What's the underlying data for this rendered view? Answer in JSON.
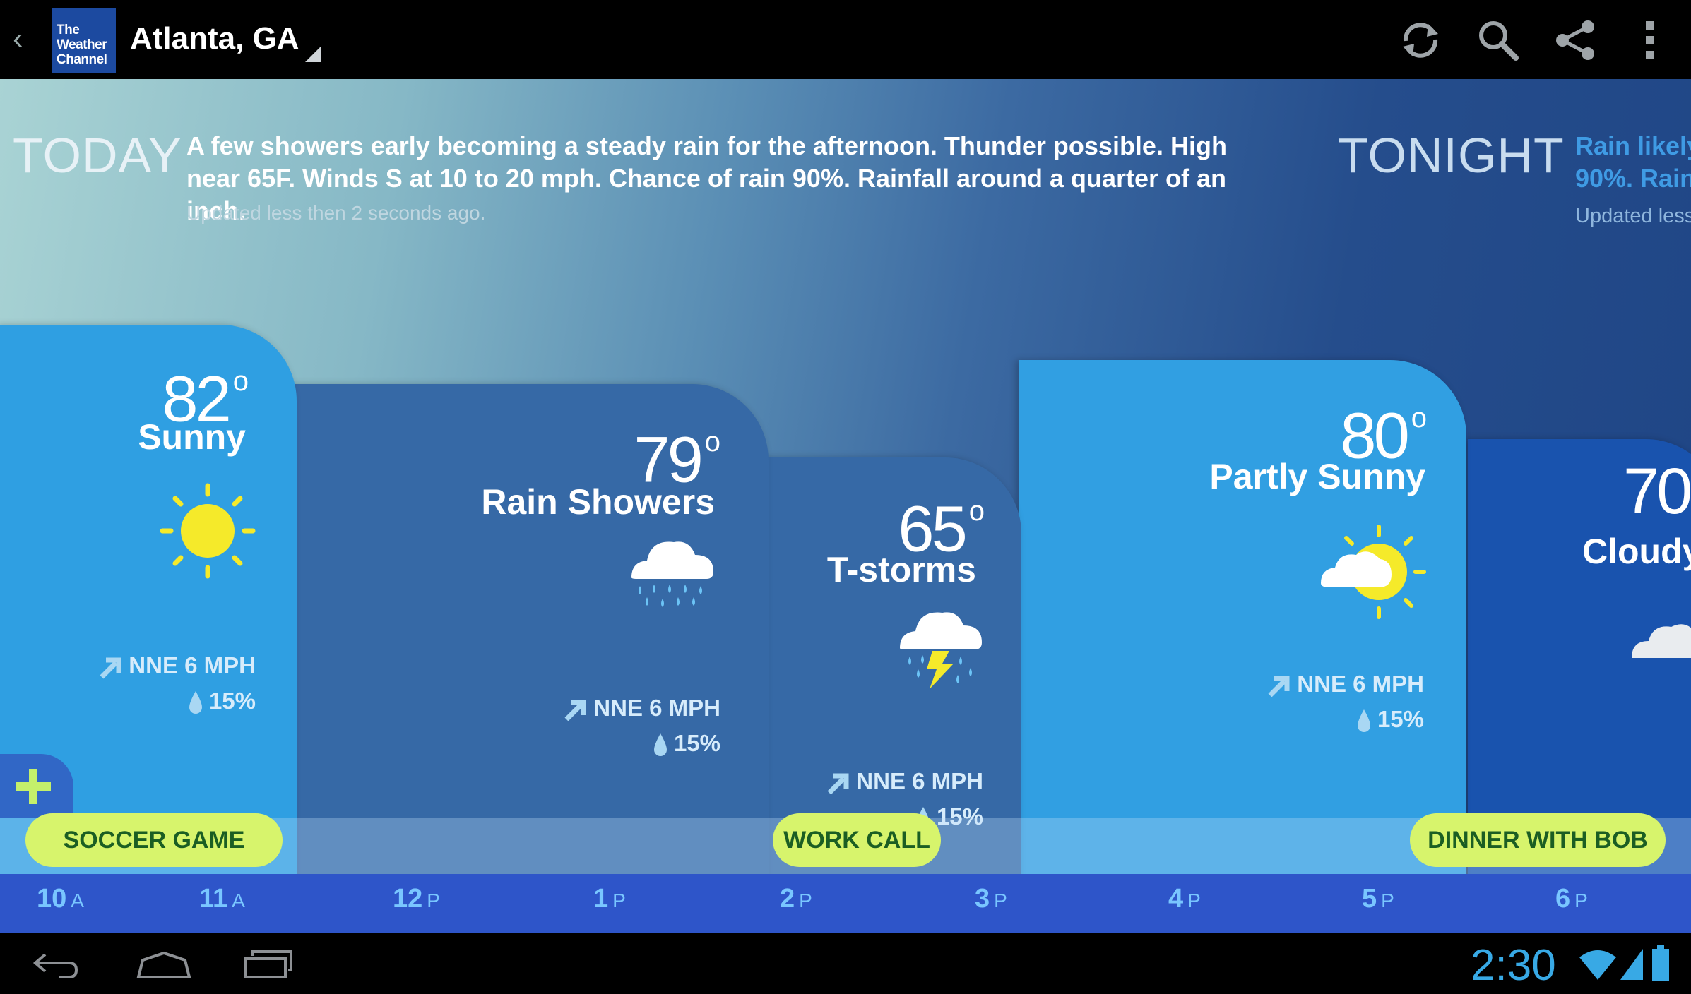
{
  "header": {
    "logo_lines": [
      "The",
      "Weather",
      "Channel"
    ],
    "city": "Atlanta, GA"
  },
  "today": {
    "label": "TODAY",
    "text": "A few showers early becoming a steady rain for the afternoon. Thunder possible. High near 65F. Winds S at 10 to 20 mph. Chance of rain 90%. Rainfall around a quarter of an inch.",
    "updated": "Updated less then 2 seconds ago."
  },
  "tonight": {
    "label": "TONIGHT",
    "text_line1": "Rain likely",
    "text_line2": "90%. Rain",
    "updated": "Updated less"
  },
  "forecasts": [
    {
      "temp": "82",
      "degree": "o",
      "condition": "Sunny",
      "wind": "NNE 6 MPH",
      "precip": "15%",
      "icon": "sun-icon"
    },
    {
      "temp": "79",
      "degree": "o",
      "condition": "Rain Showers",
      "wind": "NNE 6 MPH",
      "precip": "15%",
      "icon": "rain-cloud-icon"
    },
    {
      "temp": "65",
      "degree": "o",
      "condition": "T-storms",
      "wind": "NNE 6 MPH",
      "precip": "15%",
      "icon": "thunderstorm-icon"
    },
    {
      "temp": "80",
      "degree": "o",
      "condition": "Partly Sunny",
      "wind": "NNE 6 MPH",
      "precip": "15%",
      "icon": "partly-sunny-icon"
    },
    {
      "temp": "70",
      "condition": "Cloudy",
      "icon": "cloud-icon"
    }
  ],
  "events": [
    "SOCCER GAME",
    "WORK CALL",
    "DINNER WITH BOB"
  ],
  "timeline": [
    {
      "hour": "10",
      "ampm": "A"
    },
    {
      "hour": "11",
      "ampm": "A"
    },
    {
      "hour": "12",
      "ampm": "P"
    },
    {
      "hour": "1",
      "ampm": "P"
    },
    {
      "hour": "2",
      "ampm": "P"
    },
    {
      "hour": "3",
      "ampm": "P"
    },
    {
      "hour": "4",
      "ampm": "P"
    },
    {
      "hour": "5",
      "ampm": "P"
    },
    {
      "hour": "6",
      "ampm": "P"
    }
  ],
  "status": {
    "clock": "2:30"
  },
  "colors": {
    "accent_green": "#d7f46c",
    "time_axis": "#2e55c9",
    "card_light": "#2f9fe2",
    "card_dark": "#3467a6"
  }
}
